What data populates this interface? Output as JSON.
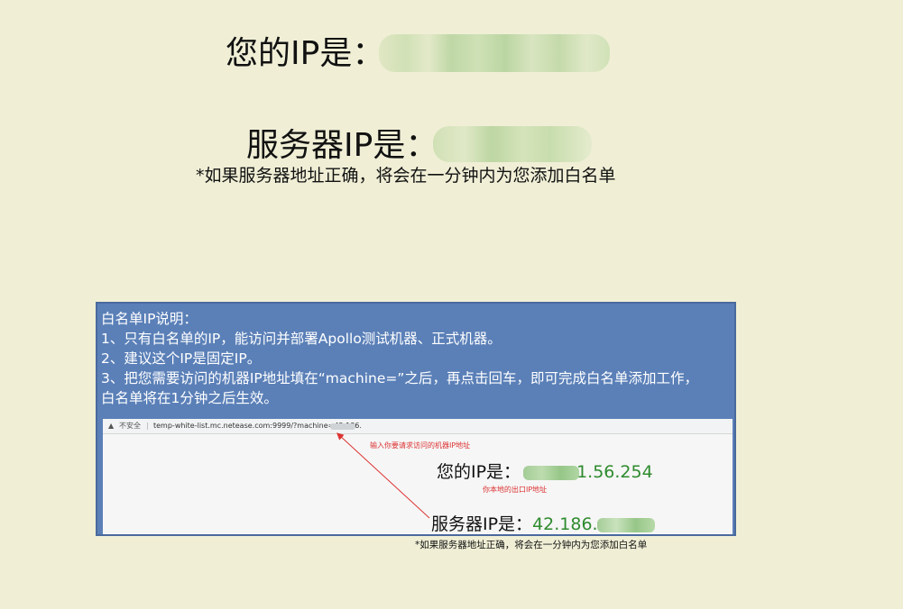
{
  "main": {
    "your_ip_label": "您的IP是：",
    "server_ip_label": "服务器IP是：",
    "notice": "*如果服务器地址正确，将会在一分钟内为您添加白名单"
  },
  "panel": {
    "lines": [
      "白名单IP说明：",
      "1、只有白名单的IP，能访问并部署Apollo测试机器、正式机器。",
      "2、建议这个IP是固定IP。",
      "3、把您需要访问的机器IP地址填在“machine=”之后，再点击回车，即可完成白名单添加工作，",
      "白名单将在1分钟之后生效。"
    ]
  },
  "screenshot": {
    "insecure_label": "不安全",
    "url": "temp-white-list.mc.netease.com:9999/?machine=42.186.",
    "annotation_input": "输入你要请求访问的机器IP地址",
    "your_ip_label": "您的IP是：",
    "your_ip_value": "1.56.254",
    "annotation_local": "你本地的出口IP地址",
    "server_ip_label": "服务器IP是：",
    "server_ip_value": "42.186.",
    "notice": "*如果服务器地址正确，将会在一分钟内为您添加白名单"
  },
  "colors": {
    "page_bg": "#f0efd6",
    "panel_bg": "#5b80b8",
    "ip_value": "#2e8b2e",
    "annotation": "#dd3333"
  }
}
